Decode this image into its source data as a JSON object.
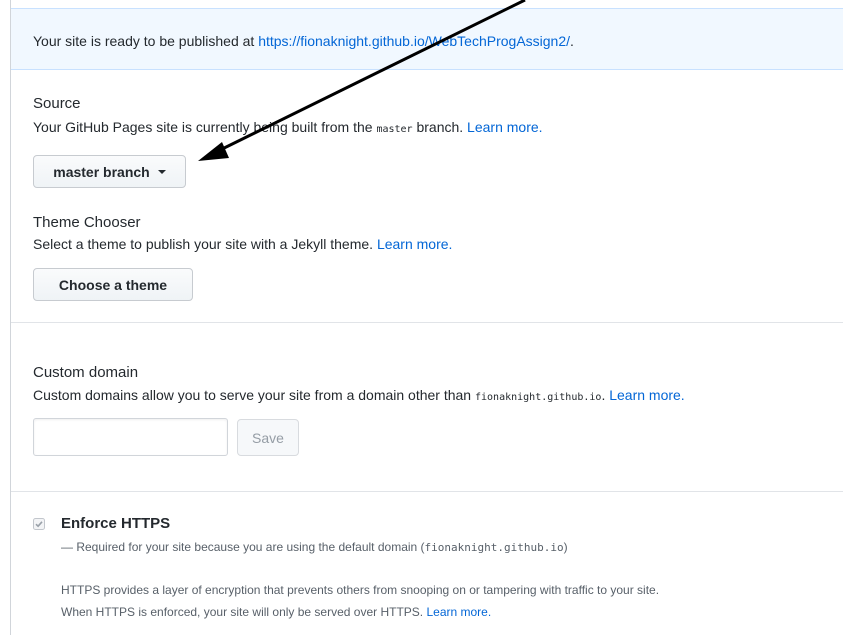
{
  "banner": {
    "text": "Your site is ready to be published at",
    "url": "https://fionaknight.github.io/WebTechProgAssign2/",
    "suffix": "."
  },
  "source": {
    "heading": "Source",
    "desc_before": "Your GitHub Pages site is currently being built from the",
    "branch_code": "master",
    "desc_after": "branch.",
    "learn_more": "Learn more.",
    "dropdown_label": "master branch"
  },
  "theme": {
    "heading": "Theme Chooser",
    "desc": "Select a theme to publish your site with a Jekyll theme.",
    "learn_more": "Learn more.",
    "button_label": "Choose a theme"
  },
  "custom_domain": {
    "heading": "Custom domain",
    "desc_before": "Custom domains allow you to serve your site from a domain other than",
    "domain_code": "fionaknight.github.io",
    "desc_after": ".",
    "learn_more": "Learn more.",
    "input_value": "",
    "save_label": "Save"
  },
  "https": {
    "label": "Enforce HTTPS",
    "checked": true,
    "note_before": "— Required for your site because you are using the default domain (",
    "note_domain": "fionaknight.github.io",
    "note_after": ")",
    "info_line1": "HTTPS provides a layer of encryption that prevents others from snooping on or tampering with traffic to your site.",
    "info_line2": "When HTTPS is enforced, your site will only be served over HTTPS.",
    "learn_more": "Learn more."
  },
  "colors": {
    "link": "#0366d6",
    "banner_bg": "#f1f8ff",
    "arrow": "#000000"
  },
  "icons": {
    "dropdown": "caret-down-icon",
    "checkbox": "checkbox-checked-icon"
  }
}
